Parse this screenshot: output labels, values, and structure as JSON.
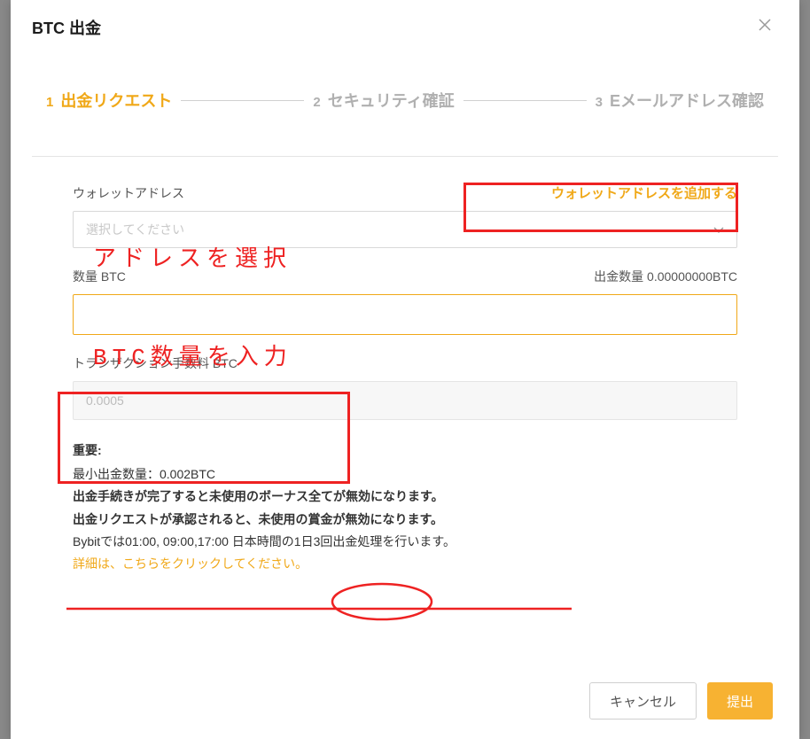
{
  "modal": {
    "title": "BTC 出金"
  },
  "steps": {
    "step1": {
      "num": "1",
      "label": "出金リクエスト"
    },
    "step2": {
      "num": "2",
      "label": "セキュリティ確証"
    },
    "step3": {
      "num": "3",
      "label": "Eメールアドレス確認"
    }
  },
  "walletSection": {
    "label": "ウォレットアドレス",
    "addLink": "ウォレットアドレスを追加する",
    "selectPlaceholder": "選択してください"
  },
  "amountSection": {
    "label": "数量 BTC",
    "withdrawLabel": "出金数量",
    "withdrawValue": "0.00000000BTC",
    "inputValue": ""
  },
  "feeSection": {
    "label": "トランザクション手数料 BTC",
    "value": "0.0005"
  },
  "important": {
    "title": "重要:",
    "minWithdraw": "最小出金数量：0.002BTC",
    "line1": "出金手続きが完了すると未使用のボーナス全てが無効になります。",
    "line2": "出金リクエストが承認されると、未使用の賞金が無効になります。",
    "schedule": "Bybitでは01:00, 09:00,17:00 日本時間の1日3回出金処理を行います。",
    "detailLink": "詳細は、こちらをクリックしてください。"
  },
  "footer": {
    "cancel": "キャンセル",
    "submit": "提出"
  },
  "annotations": {
    "selectAddress": "アドレスを選択",
    "enterAmount": "BTC数量を入力"
  }
}
